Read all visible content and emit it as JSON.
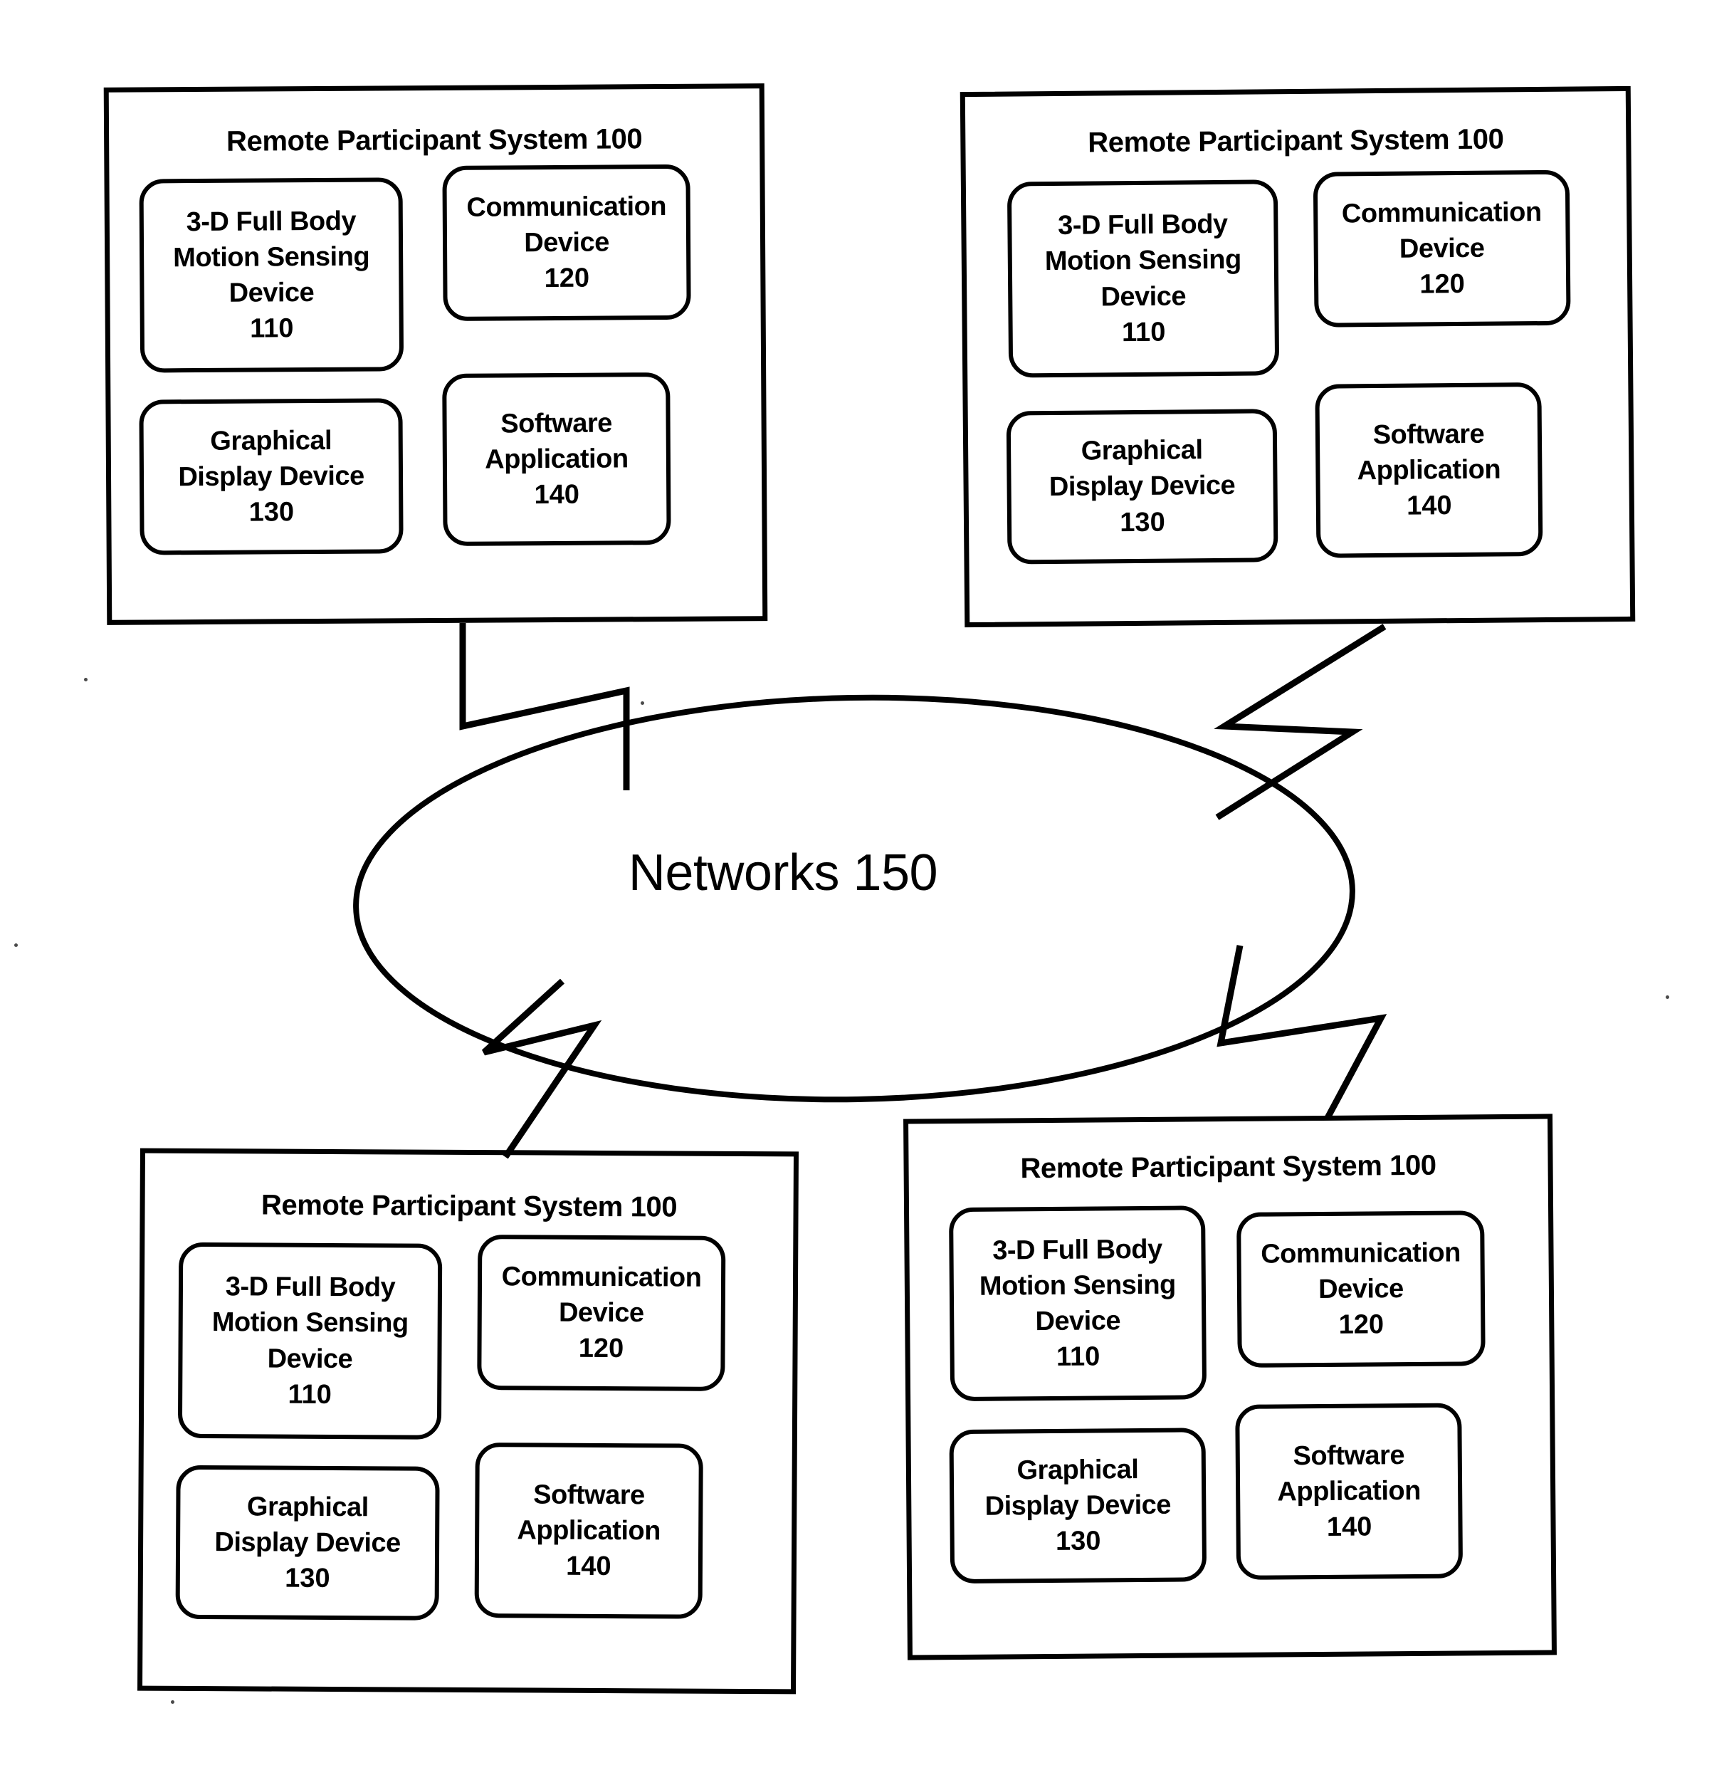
{
  "figure": {
    "type": "patent-block-diagram",
    "background_color": "#ffffff",
    "line_color": "#000000"
  },
  "network": {
    "label": "Networks 150",
    "shape": "ellipse"
  },
  "components": {
    "sensing": {
      "line1": "3-D Full Body",
      "line2": "Motion Sensing",
      "line3": "Device",
      "number": "110"
    },
    "communication": {
      "line1": "Communication",
      "line2": "Device",
      "number": "120"
    },
    "display": {
      "line1": "Graphical",
      "line2": "Display Device",
      "number": "130"
    },
    "software": {
      "line1": "Software",
      "line2": "Application",
      "number": "140"
    }
  },
  "systems": [
    {
      "id": "top-left",
      "title": "Remote Participant System 100",
      "blocks": [
        {
          "key": "sensing",
          "line1": "3-D Full Body",
          "line2": "Motion Sensing",
          "line3": "Device",
          "number": "110"
        },
        {
          "key": "communication",
          "line1": "Communication",
          "line2": "Device",
          "line3": "",
          "number": "120"
        },
        {
          "key": "display",
          "line1": "Graphical",
          "line2": "Display Device",
          "line3": "",
          "number": "130"
        },
        {
          "key": "software",
          "line1": "Software",
          "line2": "Application",
          "line3": "",
          "number": "140"
        }
      ]
    },
    {
      "id": "top-right",
      "title": "Remote Participant System 100",
      "blocks": [
        {
          "key": "sensing",
          "line1": "3-D Full Body",
          "line2": "Motion Sensing",
          "line3": "Device",
          "number": "110"
        },
        {
          "key": "communication",
          "line1": "Communication",
          "line2": "Device",
          "line3": "",
          "number": "120"
        },
        {
          "key": "display",
          "line1": "Graphical",
          "line2": "Display Device",
          "line3": "",
          "number": "130"
        },
        {
          "key": "software",
          "line1": "Software",
          "line2": "Application",
          "line3": "",
          "number": "140"
        }
      ]
    },
    {
      "id": "bottom-left",
      "title": "Remote Participant System 100",
      "blocks": [
        {
          "key": "sensing",
          "line1": "3-D Full Body",
          "line2": "Motion Sensing",
          "line3": "Device",
          "number": "110"
        },
        {
          "key": "communication",
          "line1": "Communication",
          "line2": "Device",
          "line3": "",
          "number": "120"
        },
        {
          "key": "display",
          "line1": "Graphical",
          "line2": "Display Device",
          "line3": "",
          "number": "130"
        },
        {
          "key": "software",
          "line1": "Software",
          "line2": "Application",
          "line3": "",
          "number": "140"
        }
      ]
    },
    {
      "id": "bottom-right",
      "title": "Remote Participant System 100",
      "blocks": [
        {
          "key": "sensing",
          "line1": "3-D Full Body",
          "line2": "Motion Sensing",
          "line3": "Device",
          "number": "110"
        },
        {
          "key": "communication",
          "line1": "Communication",
          "line2": "Device",
          "line3": "",
          "number": "120"
        },
        {
          "key": "display",
          "line1": "Graphical",
          "line2": "Display Device",
          "line3": "",
          "number": "130"
        },
        {
          "key": "software",
          "line1": "Software",
          "line2": "Application",
          "line3": "",
          "number": "140"
        }
      ]
    }
  ],
  "connectors": [
    {
      "from": "top-left",
      "to": "network",
      "style": "lightning-bolt"
    },
    {
      "from": "top-right",
      "to": "network",
      "style": "lightning-bolt"
    },
    {
      "from": "bottom-left",
      "to": "network",
      "style": "lightning-bolt"
    },
    {
      "from": "bottom-right",
      "to": "network",
      "style": "lightning-bolt"
    }
  ]
}
